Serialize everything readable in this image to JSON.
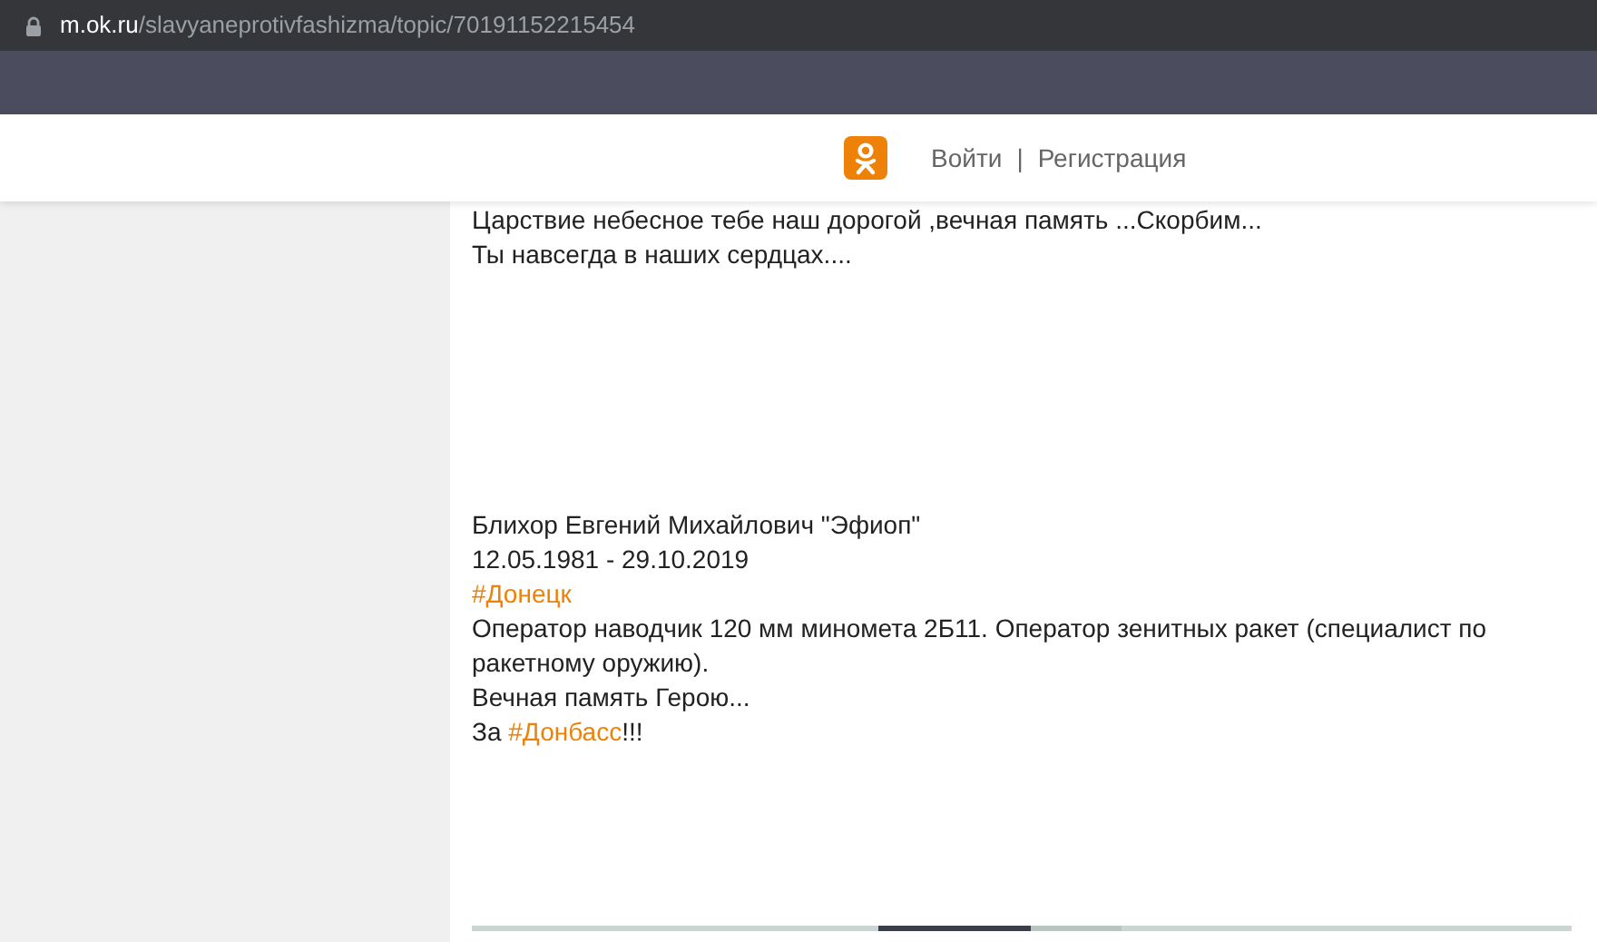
{
  "browser": {
    "url_host": "m.ok.ru",
    "url_path": "/slavyaneprotivfashizma/topic/70191152215454"
  },
  "header": {
    "login": "Войти",
    "separator": "|",
    "register": "Регистрация"
  },
  "post": {
    "blocks": [
      {
        "lines": [
          [
            {
              "kind": "text",
              "text": "Царствие небесное тебе наш дорогой ,вечная память ...Скорбим..."
            }
          ],
          [
            {
              "kind": "text",
              "text": "Ты навсегда в наших сердцах...."
            }
          ]
        ]
      },
      {
        "lines": [
          [
            {
              "kind": "text",
              "text": "Блихор Евгений Михайлович \"Эфиоп\""
            }
          ],
          [
            {
              "kind": "text",
              "text": "12.05.1981 - 29.10.2019"
            }
          ],
          [
            {
              "kind": "hashtag",
              "text": "#Донецк"
            }
          ],
          [
            {
              "kind": "text",
              "text": "Оператор наводчик 120 мм миномета 2Б11. Оператор зенитных ракет (специалист по ракетному оружию)."
            }
          ],
          [
            {
              "kind": "text",
              "text": "Вечная память Герою..."
            }
          ],
          [
            {
              "kind": "text",
              "text": "За "
            },
            {
              "kind": "hashtag",
              "text": "#Донбасс"
            },
            {
              "kind": "text",
              "text": "!!!"
            }
          ]
        ]
      }
    ]
  }
}
